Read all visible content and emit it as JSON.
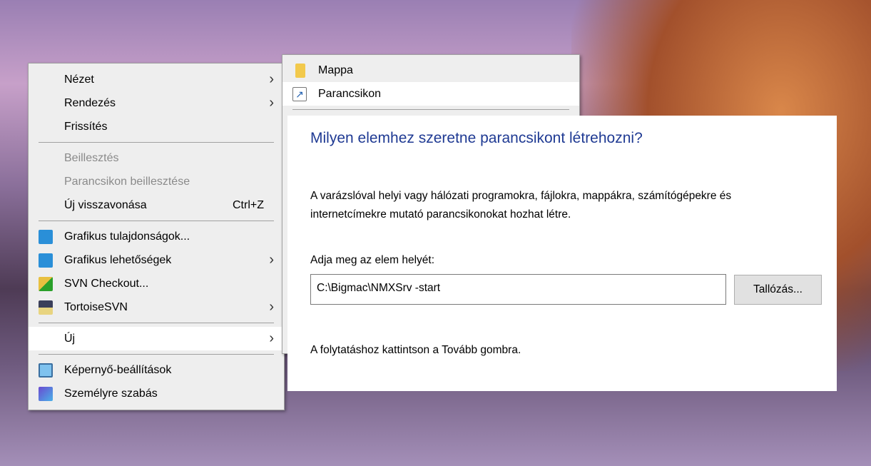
{
  "context_menu": {
    "items": [
      {
        "label": "Nézet",
        "submenu": true
      },
      {
        "label": "Rendezés",
        "submenu": true
      },
      {
        "label": "Frissítés"
      },
      {
        "label": "Beillesztés",
        "disabled": true
      },
      {
        "label": "Parancsikon beillesztése",
        "disabled": true
      },
      {
        "label": "Új visszavonása",
        "shortcut": "Ctrl+Z"
      },
      {
        "label": "Grafikus tulajdonságok...",
        "icon": "intel-graphics-icon"
      },
      {
        "label": "Grafikus lehetőségek",
        "icon": "intel-graphics-icon",
        "submenu": true
      },
      {
        "label": "SVN Checkout...",
        "icon": "svn-checkout-icon"
      },
      {
        "label": "TortoiseSVN",
        "icon": "tortoisesvn-icon",
        "submenu": true
      },
      {
        "label": "Új",
        "submenu": true
      },
      {
        "label": "Képernyő-beállítások",
        "icon": "display-icon"
      },
      {
        "label": "Személyre szabás",
        "icon": "personalize-icon"
      }
    ]
  },
  "submenu": {
    "items": [
      {
        "label": "Mappa",
        "icon": "folder-icon"
      },
      {
        "label": "Parancsikon",
        "icon": "shortcut-icon"
      }
    ]
  },
  "dialog": {
    "title": "Milyen elemhez szeretne parancsikont létrehozni?",
    "description": "A varázslóval helyi vagy hálózati programokra, fájlokra, mappákra, számítógépekre és internetcímekre mutató parancsikonokat hozhat létre.",
    "location_label": "Adja meg az elem helyét:",
    "location_value": "C:\\Bigmac\\NMXSrv -start",
    "browse_label": "Tallózás...",
    "hint": "A folytatáshoz kattintson a Tovább gombra."
  }
}
